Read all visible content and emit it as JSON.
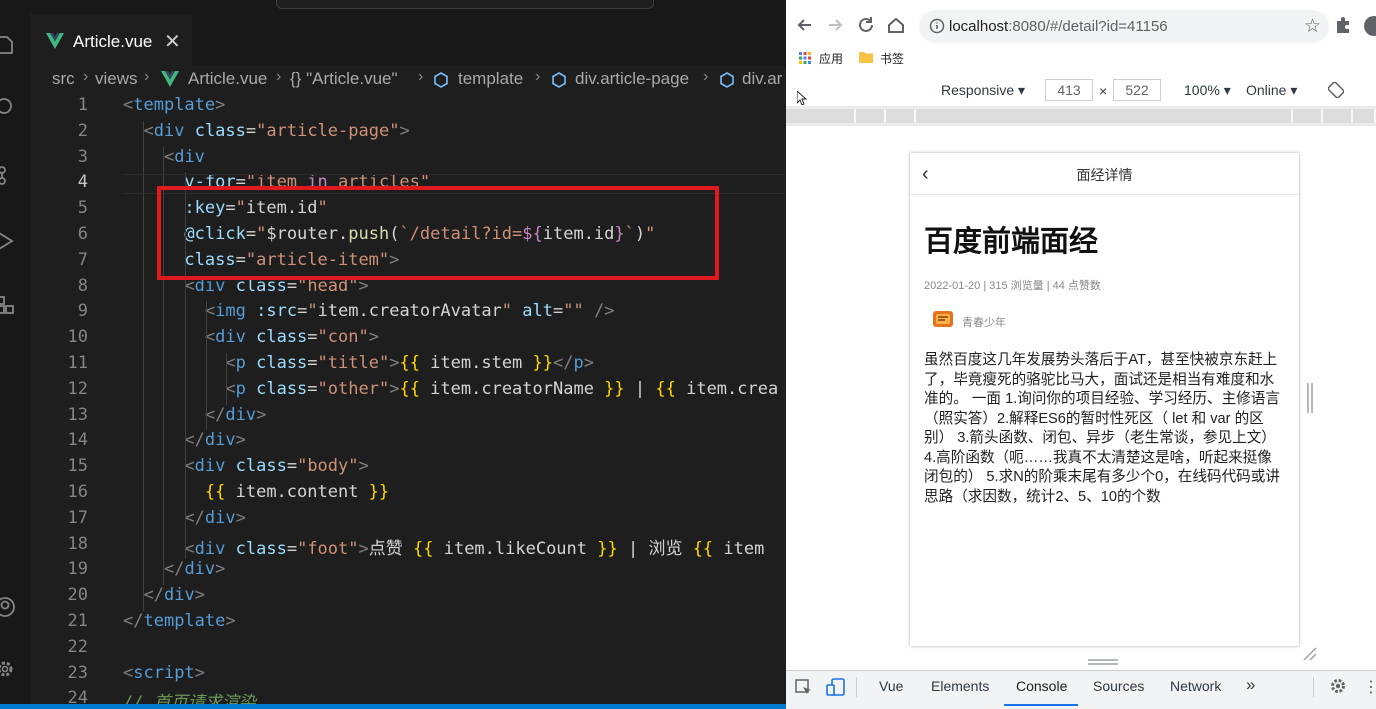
{
  "editor": {
    "tab_title": "Article.vue",
    "tab_close": "✕",
    "breadcrumb": [
      "src",
      "views",
      "Article.vue",
      "{} \"Article.vue\"",
      "template",
      "div.article-page",
      "div.ar"
    ],
    "line_numbers": [
      "1",
      "2",
      "3",
      "4",
      "5",
      "6",
      "7",
      "8",
      "9",
      "10",
      "11",
      "12",
      "13",
      "14",
      "15",
      "16",
      "17",
      "18",
      "19",
      "20",
      "21",
      "22",
      "23",
      "24"
    ],
    "lines": [
      [
        [
          "br",
          "<"
        ],
        [
          "tag",
          "template"
        ],
        [
          "br",
          ">"
        ]
      ],
      [
        [
          "w",
          "  "
        ],
        [
          "br",
          "<"
        ],
        [
          "tag",
          "div"
        ],
        [
          "w",
          " "
        ],
        [
          "attr",
          "class"
        ],
        [
          "w",
          "="
        ],
        [
          "str",
          "\"article-page\""
        ],
        [
          "br",
          ">"
        ]
      ],
      [
        [
          "w",
          "    "
        ],
        [
          "br",
          "<"
        ],
        [
          "tag",
          "div"
        ]
      ],
      [
        [
          "w",
          "      "
        ],
        [
          "attr",
          "v-for"
        ],
        [
          "w",
          "="
        ],
        [
          "str",
          "\"item "
        ],
        [
          "dir",
          "in"
        ],
        [
          "str",
          " articles\""
        ]
      ],
      [
        [
          "w",
          "      "
        ],
        [
          "attr",
          ":key"
        ],
        [
          "w",
          "="
        ],
        [
          "str",
          "\""
        ],
        [
          "white",
          "item.id"
        ],
        [
          "str",
          "\""
        ]
      ],
      [
        [
          "w",
          "      "
        ],
        [
          "attr",
          "@click"
        ],
        [
          "w",
          "="
        ],
        [
          "str",
          "\""
        ],
        [
          "white",
          "$router."
        ],
        [
          "fn",
          "push"
        ],
        [
          "white",
          "("
        ],
        [
          "str",
          "`/detail?id="
        ],
        [
          "dir",
          "${"
        ],
        [
          "white",
          "item.id"
        ],
        [
          "dir",
          "}"
        ],
        [
          "str",
          "`"
        ],
        [
          "white",
          ")"
        ],
        [
          "str",
          "\""
        ]
      ],
      [
        [
          "w",
          "      "
        ],
        [
          "attr",
          "class"
        ],
        [
          "w",
          "="
        ],
        [
          "str",
          "\"article-item\""
        ],
        [
          "br",
          ">"
        ]
      ],
      [
        [
          "w",
          "      "
        ],
        [
          "br",
          "<"
        ],
        [
          "tag",
          "div"
        ],
        [
          "w",
          " "
        ],
        [
          "attr",
          "class"
        ],
        [
          "w",
          "="
        ],
        [
          "str",
          "\"head\""
        ],
        [
          "br",
          ">"
        ]
      ],
      [
        [
          "w",
          "        "
        ],
        [
          "br",
          "<"
        ],
        [
          "tag",
          "img"
        ],
        [
          "w",
          " "
        ],
        [
          "attr",
          ":src"
        ],
        [
          "w",
          "="
        ],
        [
          "str",
          "\""
        ],
        [
          "white",
          "item.creatorAvatar"
        ],
        [
          "str",
          "\""
        ],
        [
          "w",
          " "
        ],
        [
          "attr",
          "alt"
        ],
        [
          "w",
          "="
        ],
        [
          "str",
          "\"\""
        ],
        [
          "w",
          " "
        ],
        [
          "br",
          "/>"
        ]
      ],
      [
        [
          "w",
          "        "
        ],
        [
          "br",
          "<"
        ],
        [
          "tag",
          "div"
        ],
        [
          "w",
          " "
        ],
        [
          "attr",
          "class"
        ],
        [
          "w",
          "="
        ],
        [
          "str",
          "\"con\""
        ],
        [
          "br",
          ">"
        ]
      ],
      [
        [
          "w",
          "          "
        ],
        [
          "br",
          "<"
        ],
        [
          "tag",
          "p"
        ],
        [
          "w",
          " "
        ],
        [
          "attr",
          "class"
        ],
        [
          "w",
          "="
        ],
        [
          "str",
          "\"title\""
        ],
        [
          "br",
          ">"
        ],
        [
          "must",
          "{{"
        ],
        [
          "white",
          " item.stem "
        ],
        [
          "must",
          "}}"
        ],
        [
          "br",
          "</"
        ],
        [
          "tag",
          "p"
        ],
        [
          "br",
          ">"
        ]
      ],
      [
        [
          "w",
          "          "
        ],
        [
          "br",
          "<"
        ],
        [
          "tag",
          "p"
        ],
        [
          "w",
          " "
        ],
        [
          "attr",
          "class"
        ],
        [
          "w",
          "="
        ],
        [
          "str",
          "\"other\""
        ],
        [
          "br",
          ">"
        ],
        [
          "must",
          "{{"
        ],
        [
          "white",
          " item.creatorName "
        ],
        [
          "must",
          "}}"
        ],
        [
          "white",
          " | "
        ],
        [
          "must",
          "{{"
        ],
        [
          "white",
          " item.crea"
        ]
      ],
      [
        [
          "w",
          "        "
        ],
        [
          "br",
          "</"
        ],
        [
          "tag",
          "div"
        ],
        [
          "br",
          ">"
        ]
      ],
      [
        [
          "w",
          "      "
        ],
        [
          "br",
          "</"
        ],
        [
          "tag",
          "div"
        ],
        [
          "br",
          ">"
        ]
      ],
      [
        [
          "w",
          "      "
        ],
        [
          "br",
          "<"
        ],
        [
          "tag",
          "div"
        ],
        [
          "w",
          " "
        ],
        [
          "attr",
          "class"
        ],
        [
          "w",
          "="
        ],
        [
          "str",
          "\"body\""
        ],
        [
          "br",
          ">"
        ]
      ],
      [
        [
          "w",
          "        "
        ],
        [
          "must",
          "{{"
        ],
        [
          "white",
          " item.content "
        ],
        [
          "must",
          "}}"
        ]
      ],
      [
        [
          "w",
          "      "
        ],
        [
          "br",
          "</"
        ],
        [
          "tag",
          "div"
        ],
        [
          "br",
          ">"
        ]
      ],
      [
        [
          "w",
          "      "
        ],
        [
          "br",
          "<"
        ],
        [
          "tag",
          "div"
        ],
        [
          "w",
          " "
        ],
        [
          "attr",
          "class"
        ],
        [
          "w",
          "="
        ],
        [
          "str",
          "\"foot\""
        ],
        [
          "br",
          ">"
        ],
        [
          "white",
          "点赞 "
        ],
        [
          "must",
          "{{"
        ],
        [
          "white",
          " item.likeCount "
        ],
        [
          "must",
          "}}"
        ],
        [
          "white",
          " | 浏览 "
        ],
        [
          "must",
          "{{"
        ],
        [
          "white",
          " item"
        ]
      ],
      [
        [
          "w",
          "    "
        ],
        [
          "br",
          "</"
        ],
        [
          "tag",
          "div"
        ],
        [
          "br",
          ">"
        ]
      ],
      [
        [
          "w",
          "  "
        ],
        [
          "br",
          "</"
        ],
        [
          "tag",
          "div"
        ],
        [
          "br",
          ">"
        ]
      ],
      [
        [
          "br",
          "</"
        ],
        [
          "tag",
          "template"
        ],
        [
          "br",
          ">"
        ]
      ],
      [
        [
          "w",
          ""
        ]
      ],
      [
        [
          "br",
          "<"
        ],
        [
          "tag",
          "script"
        ],
        [
          "br",
          ">"
        ]
      ],
      [
        [
          "cmt",
          "// 首页请求渲染"
        ]
      ]
    ]
  },
  "browser": {
    "url_host": "localhost",
    "url_rest": ":8080/#/detail?id=41156",
    "bookmarks": [
      "应用",
      "书签"
    ],
    "devtools_bar": {
      "device": "Responsive",
      "width": "413",
      "times": "×",
      "height": "522",
      "zoom": "100%",
      "network": "Online"
    },
    "devtools_tabs": [
      "Vue",
      "Elements",
      "Console",
      "Sources",
      "Network",
      "»"
    ],
    "active_tab": "Console"
  },
  "page": {
    "header_title": "面经详情",
    "back": "‹",
    "title": "百度前端面经",
    "meta": "2022-01-20 | 315 浏览量 | 44 点赞数",
    "author": "青春少年",
    "body": "虽然百度这几年发展势头落后于AT，甚至快被京东赶上了，毕竟瘦死的骆驼比马大，面试还是相当有难度和水准的。 一面 1.询问你的项目经验、学习经历、主修语言（照实答）2.解释ES6的暂时性死区（ let 和 var 的区别） 3.箭头函数、闭包、异步（老生常谈，参见上文）4.高阶函数（呃……我真不太清楚这是啥，听起来挺像闭包的） 5.求N的阶乘末尾有多少个0，在线码代码或讲思路（求因数，统计2、5、10的个数"
  },
  "colors": {
    "editor_bg": "#1e1e1e",
    "highlight_box": "#e0191e",
    "vue_green": "#41b883",
    "devtools_active": "#1a73e8"
  }
}
